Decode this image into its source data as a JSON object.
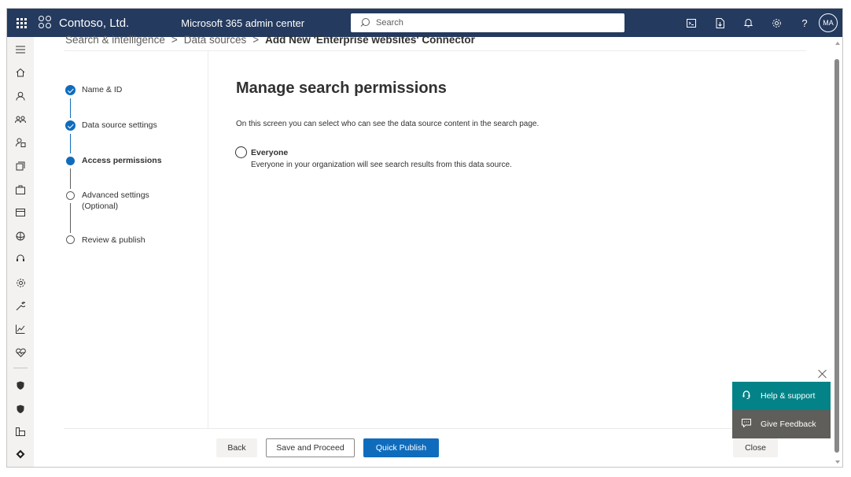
{
  "topbar": {
    "org_name": "Contoso, Ltd.",
    "app_name": "Microsoft 365 admin center",
    "search_placeholder": "Search",
    "avatar_initials": "MA",
    "icons": [
      "terminal-icon",
      "download-app-icon",
      "bell-icon",
      "gear-icon",
      "help-icon"
    ]
  },
  "nav": {
    "icons": [
      "hamburger-icon",
      "home-icon",
      "user-icon",
      "groups-icon",
      "roles-icon",
      "resources-icon",
      "marketplace-icon",
      "billing-icon",
      "setup-icon",
      "support-icon",
      "settings-icon",
      "wrench-icon",
      "reports-icon",
      "health-icon",
      "shield-icon",
      "defender-icon",
      "more-icon",
      "edge-icon"
    ]
  },
  "breadcrumb": {
    "item1": "Search & intelligence",
    "item2": "Data sources",
    "current": "Add New 'Enterprise websites' Connector"
  },
  "steps": [
    {
      "label": "Name & ID",
      "status": "done"
    },
    {
      "label": "Data source settings",
      "status": "done"
    },
    {
      "label": "Access permissions",
      "status": "current"
    },
    {
      "label": "Advanced settings",
      "label2": "(Optional)",
      "status": "todo"
    },
    {
      "label": "Review & publish",
      "status": "todo"
    }
  ],
  "main": {
    "title": "Manage search permissions",
    "description": "On this screen you can select who can see the data source content in the search page.",
    "option_label": "Everyone",
    "option_desc": "Everyone in your organization will see search results from this data source."
  },
  "footer": {
    "back": "Back",
    "save": "Save and Proceed",
    "publish": "Quick Publish",
    "close": "Close"
  },
  "help": {
    "support": "Help & support",
    "feedback": "Give Feedback"
  },
  "colors": {
    "topbar": "#243a5e",
    "accent": "#0f6cbd",
    "help": "#038387",
    "feedback": "#5f5e5a"
  }
}
